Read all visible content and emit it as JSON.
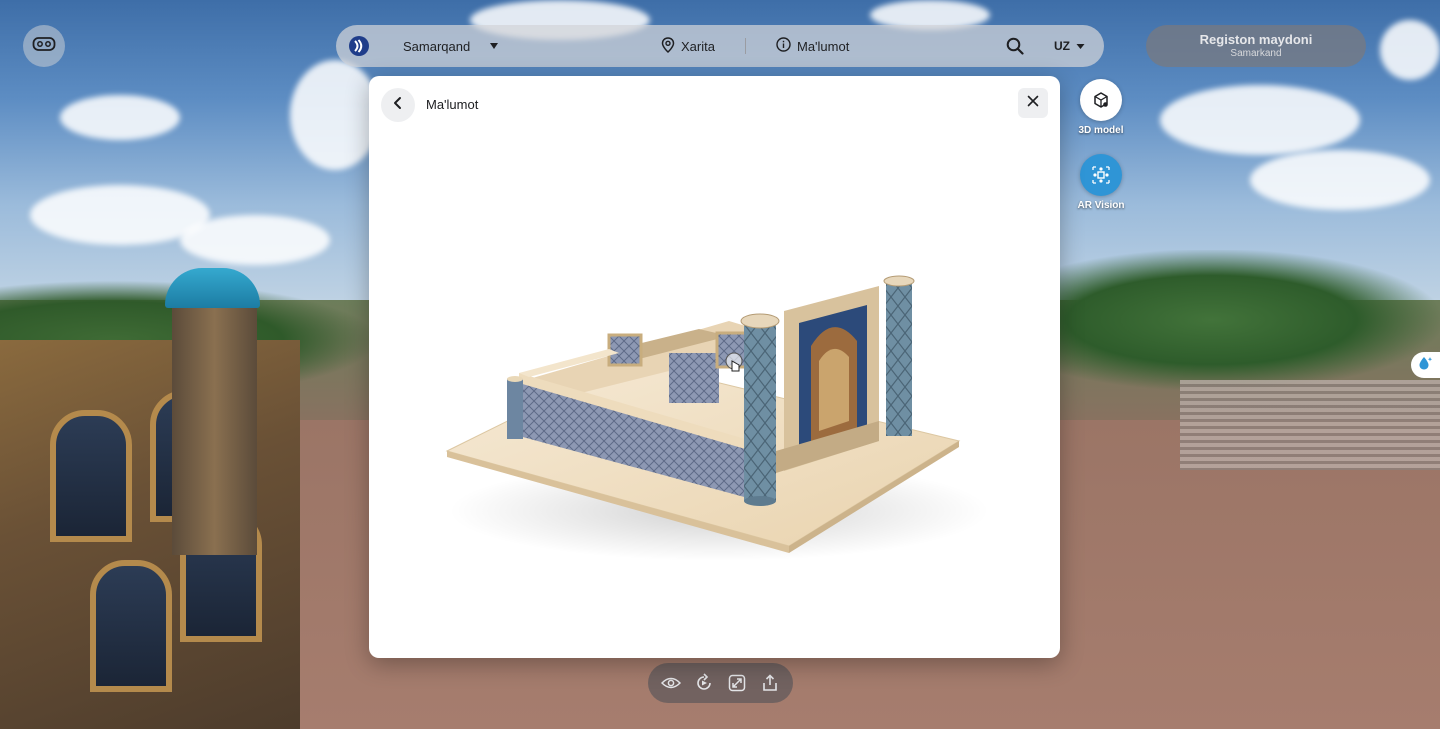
{
  "topbar": {
    "city": "Samarqand",
    "map_label": "Xarita",
    "info_label": "Ma'lumot",
    "language": "UZ"
  },
  "place": {
    "title": "Registon maydoni",
    "subtitle": "Samarkand"
  },
  "side_buttons": {
    "model3d_label": "3D model",
    "ar_label": "AR Vision"
  },
  "modal": {
    "title": "Ma'lumot"
  },
  "colors": {
    "ar_accent": "#2f95d6",
    "modal_bg": "#ffffff"
  },
  "icons": {
    "vr": "vr-headset-icon",
    "logo": "brand-logo-icon",
    "map": "map-pin-icon",
    "info": "info-icon",
    "search": "search-icon",
    "cube": "cube-icon",
    "ar": "ar-vision-icon",
    "back": "chevron-left-icon",
    "close": "close-icon",
    "eye": "eye-icon",
    "rotate": "rotate-icon",
    "fullscreen": "fullscreen-icon",
    "share": "share-icon",
    "hint": "droplet-hint-icon"
  }
}
